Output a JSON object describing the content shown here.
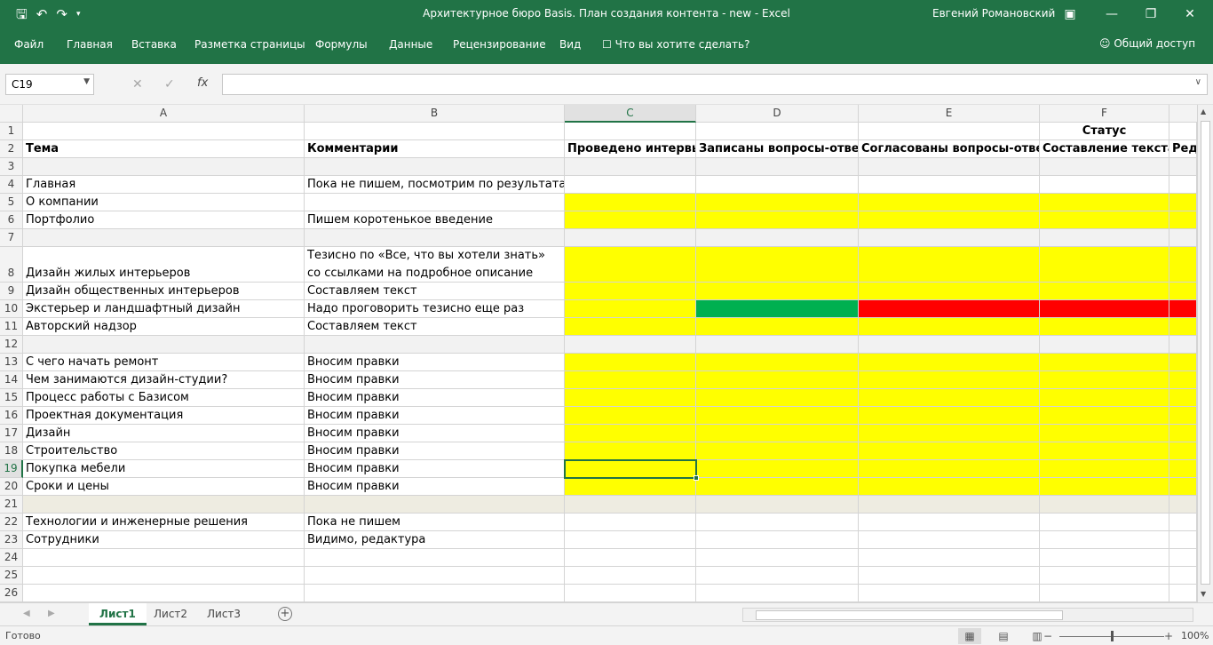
{
  "window": {
    "title": "Архитектурное бюро Basis. План создания контента - new - Excel",
    "user": "Евгений Романовский"
  },
  "qat": {
    "save_icon": "save-icon",
    "undo_icon": "undo-icon",
    "redo_icon": "redo-icon",
    "customize_icon": "qat-customize-icon"
  },
  "ribbon": {
    "tabs": [
      "Файл",
      "Главная",
      "Вставка",
      "Разметка страницы",
      "Формулы",
      "Данные",
      "Рецензирование",
      "Вид"
    ],
    "tell_me": "Что вы хотите сделать?",
    "share": "Общий доступ"
  },
  "formula_bar": {
    "name_box": "C19",
    "value": ""
  },
  "columns": [
    {
      "letter": "A",
      "selected": false
    },
    {
      "letter": "B",
      "selected": false
    },
    {
      "letter": "C",
      "selected": true
    },
    {
      "letter": "D",
      "selected": false
    },
    {
      "letter": "E",
      "selected": false
    },
    {
      "letter": "F",
      "selected": false
    }
  ],
  "rows": [
    {
      "n": "1",
      "a": "",
      "b": "",
      "c": "",
      "d": "",
      "e": "",
      "f": "Статус",
      "g": ""
    },
    {
      "n": "2",
      "a": "Тема",
      "b": "Комментарии",
      "c": "Проведено интервью",
      "d": "Записаны вопросы-ответы",
      "e": "Согласованы вопросы-ответы",
      "f": "Составление текста",
      "g": "Ред"
    },
    {
      "n": "3",
      "a": "",
      "b": ""
    },
    {
      "n": "4",
      "a": "Главная",
      "b": "Пока не пишем, посмотрим по результатам"
    },
    {
      "n": "5",
      "a": "О компании",
      "b": ""
    },
    {
      "n": "6",
      "a": "Портфолио",
      "b": "Пишем коротенькое введение"
    },
    {
      "n": "7",
      "a": "",
      "b": ""
    },
    {
      "n": "8",
      "a": "Дизайн жилых интерьеров",
      "b": "Тезисно по «Все, что вы хотели знать» со ссылками на подробное описание"
    },
    {
      "n": "9",
      "a": "Дизайн общественных интерьеров",
      "b": "Составляем текст"
    },
    {
      "n": "10",
      "a": "Экстерьер и ландшафтный дизайн",
      "b": "Надо проговорить тезисно еще раз"
    },
    {
      "n": "11",
      "a": "Авторский надзор",
      "b": "Составляем текст"
    },
    {
      "n": "12",
      "a": "",
      "b": ""
    },
    {
      "n": "13",
      "a": "С чего начать ремонт",
      "b": "Вносим правки"
    },
    {
      "n": "14",
      "a": "Чем занимаются дизайн-студии?",
      "b": "Вносим правки"
    },
    {
      "n": "15",
      "a": "Процесс работы с Базисом",
      "b": "Вносим правки"
    },
    {
      "n": "16",
      "a": "Проектная документация",
      "b": "Вносим правки"
    },
    {
      "n": "17",
      "a": "Дизайн",
      "b": "Вносим правки"
    },
    {
      "n": "18",
      "a": "Строительство",
      "b": "Вносим правки"
    },
    {
      "n": "19",
      "a": "Покупка мебели",
      "b": "Вносим правки"
    },
    {
      "n": "20",
      "a": "Сроки и цены",
      "b": "Вносим правки"
    },
    {
      "n": "21",
      "a": "",
      "b": ""
    },
    {
      "n": "22",
      "a": "Технологии и инженерные решения",
      "b": "Пока не пишем"
    },
    {
      "n": "23",
      "a": "Сотрудники",
      "b": "Видимо, редактура"
    },
    {
      "n": "24",
      "a": "",
      "b": ""
    },
    {
      "n": "25",
      "a": "",
      "b": ""
    },
    {
      "n": "26",
      "a": "",
      "b": ""
    }
  ],
  "colors": {
    "accent": "#217346",
    "yellow": "#ffff00",
    "green": "#00b050",
    "red": "#ff0000",
    "band_gray": "#f2f2f2",
    "band_beige": "#eeece1"
  },
  "sheets": [
    {
      "label": "Лист1",
      "active": true
    },
    {
      "label": "Лист2",
      "active": false
    },
    {
      "label": "Лист3",
      "active": false
    }
  ],
  "status": {
    "ready": "Готово",
    "zoom": "100%"
  }
}
